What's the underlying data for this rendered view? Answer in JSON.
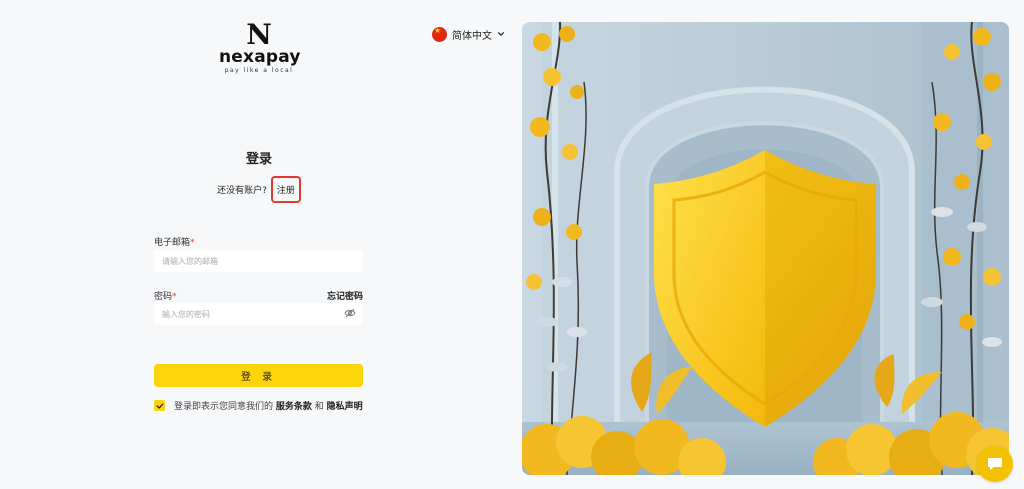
{
  "brand": {
    "initial": "N",
    "name": "nexapay",
    "tagline": "pay like a local"
  },
  "language": {
    "label": "简体中文",
    "flag_icon": "china-flag-icon"
  },
  "form": {
    "title": "登录",
    "no_account_text": "还没有账户?",
    "signup_link": "注册",
    "email_label": "电子邮箱",
    "email_placeholder": "请输入您的邮箱",
    "password_label": "密码",
    "password_placeholder": "输入您的密码",
    "forgot_password": "忘记密码",
    "required_mark": "*",
    "submit_label": "登 录",
    "agree_prefix": "登录即表示您同意我们的",
    "terms_link": "服务条款",
    "agree_and": "和",
    "privacy_link": "隐私声明",
    "agree_checked": true
  },
  "colors": {
    "accent": "#fbd40a",
    "highlight_border": "#e03a2f",
    "hero_bg": "#b6cad6",
    "shield": "#f5c518"
  },
  "icons": {
    "chevron": "chevron-down-icon",
    "eye": "eye-off-icon",
    "check": "check-icon",
    "chat": "chat-icon"
  }
}
